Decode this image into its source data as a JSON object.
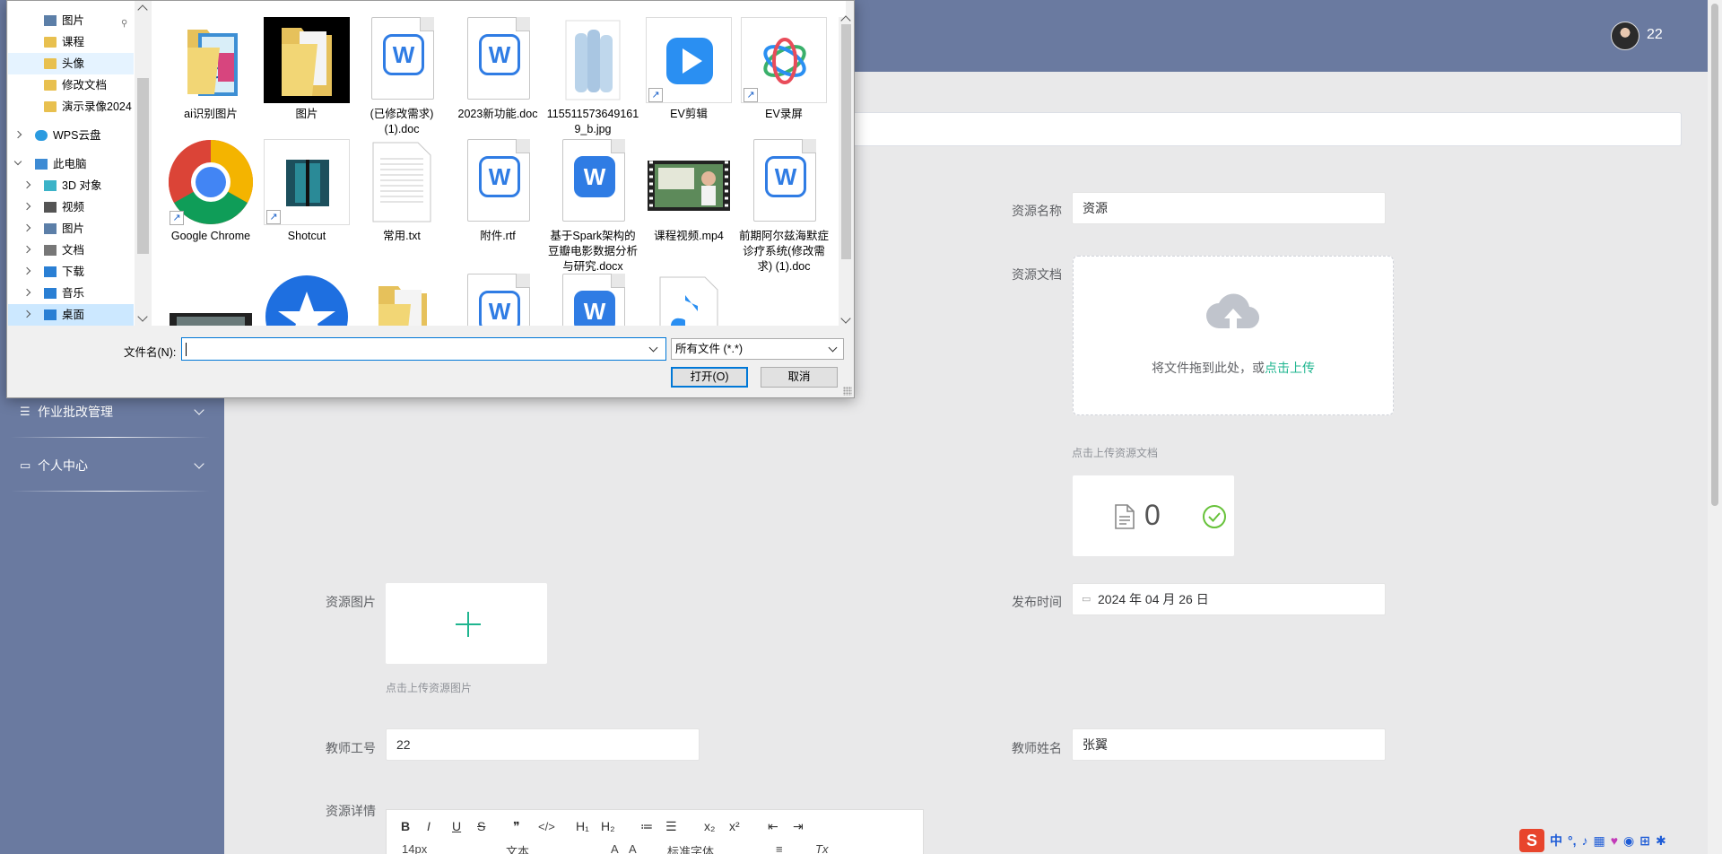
{
  "header": {
    "user_name": "22"
  },
  "sidebar": {
    "menu": [
      {
        "label": "作业批改管理",
        "icon": "sliders-icon"
      },
      {
        "label": "个人中心",
        "icon": "window-icon"
      }
    ]
  },
  "form": {
    "resource_name_label": "资源名称",
    "resource_name_value": "资源",
    "resource_doc_label": "资源文档",
    "upload_text_prefix": "将文件拖到此处，或",
    "upload_text_link": "点击上传",
    "resource_doc_tip": "点击上传资源文档",
    "file_count": "0",
    "resource_image_label": "资源图片",
    "resource_image_tip": "点击上传资源图片",
    "publish_time_label": "发布时间",
    "publish_time_value": "2024 年 04 月 26 日",
    "teacher_id_label": "教师工号",
    "teacher_id_value": "22",
    "teacher_name_label": "教师姓名",
    "teacher_name_value": "张翼",
    "resource_detail_label": "资源详情"
  },
  "editor": {
    "toolbar_row1": [
      "B",
      "I",
      "U",
      "S",
      "❞",
      "</>",
      "H₁",
      "H₂",
      "≔",
      "☰",
      "x₂",
      "x²",
      "⇤",
      "⇥"
    ],
    "font_size": "14px",
    "block_type": "文本",
    "font_family": "标准字体",
    "clear_format": "Tx"
  },
  "ime": {
    "logo": "S",
    "mode": "中",
    "punct": "°,",
    "icons": [
      "mic-icon",
      "keyboard-icon",
      "skin-icon",
      "assistant-icon",
      "grid-icon",
      "settings-icon"
    ]
  },
  "dialog": {
    "nav": [
      {
        "label": "图片",
        "icon": "pictures-icon",
        "pinned": true
      },
      {
        "label": "课程",
        "icon": "folder-icon"
      },
      {
        "label": "头像",
        "icon": "folder-icon",
        "hover": true
      },
      {
        "label": "修改文档",
        "icon": "folder-icon"
      },
      {
        "label": "演示录像2024",
        "icon": "folder-icon"
      },
      {
        "label": "WPS云盘",
        "icon": "cloud-icon"
      },
      {
        "label": "此电脑",
        "icon": "computer-icon"
      },
      {
        "label": "3D 对象",
        "icon": "cube-icon"
      },
      {
        "label": "视频",
        "icon": "video-icon"
      },
      {
        "label": "图片",
        "icon": "pictures-icon"
      },
      {
        "label": "文档",
        "icon": "document-icon"
      },
      {
        "label": "下载",
        "icon": "download-icon"
      },
      {
        "label": "音乐",
        "icon": "music-icon"
      },
      {
        "label": "桌面",
        "icon": "desktop-icon",
        "selected": true
      }
    ],
    "files": [
      "ai识别图片",
      "图片",
      "(已修改需求)(1).doc",
      "2023新功能.doc",
      "1155115736491619_b.jpg",
      "EV剪辑",
      "EV录屏",
      "Google Chrome",
      "Shotcut",
      "常用.txt",
      "附件.rtf",
      "基于Spark架构的豆瓣电影数据分析与研究.docx",
      "课程视频.mp4",
      "前期阿尔兹海默症诊疗系统(修改需求) (1).doc"
    ],
    "filename_label": "文件名(N):",
    "filename_value": "",
    "filetype_value": "所有文件 (*.*)",
    "open_button": "打开(O)",
    "cancel_button": "取消"
  }
}
